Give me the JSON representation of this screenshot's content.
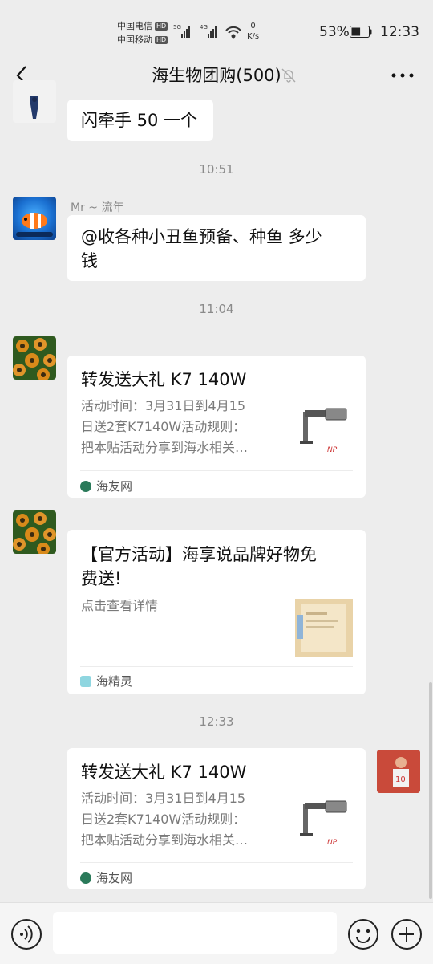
{
  "status_bar": {
    "carrier_1": "中国电信",
    "carrier_2": "中国移动",
    "hd_badge": "HD",
    "net_1": "5G",
    "net_2": "4G",
    "speed_value": "0",
    "speed_unit": "K/s",
    "battery_pct": "53%",
    "battery_level": 0.53,
    "time": "12:33"
  },
  "header": {
    "title": "海生物团购(500)"
  },
  "messages": [
    {
      "type": "text",
      "text": "闪牵手 50 一个"
    },
    {
      "type": "time",
      "text": "10:51"
    },
    {
      "type": "text",
      "sender": "Mr ~ 流年",
      "text_line1": "@收各种小丑鱼预备、种鱼  多少",
      "text_line2": "钱"
    },
    {
      "type": "time",
      "text": "11:04"
    },
    {
      "type": "card",
      "title": "转发送大礼 K7 140W",
      "desc_line1": "活动时间：3月31日到4月15",
      "desc_line2": "日送2套K7140W活动规则：",
      "desc_line3": "把本贴活动分享到海水相关…",
      "source": "海友网"
    },
    {
      "type": "card",
      "title_line1": "【官方活动】海享说品牌好物免",
      "title_line2": "费送!",
      "desc": "点击查看详情",
      "source": "海精灵"
    },
    {
      "type": "time",
      "text": "12:33"
    },
    {
      "type": "card",
      "title": "转发送大礼 K7 140W",
      "desc_line1": "活动时间：3月31日到4月15",
      "desc_line2": "日送2套K7140W活动规则：",
      "desc_line3": "把本贴活动分享到海水相关…",
      "source": "海友网"
    }
  ],
  "colors": {
    "background": "#ededed",
    "bubble": "#ffffff",
    "text": "#111111",
    "meta": "#8a8a8a"
  },
  "icons": [
    "back-icon",
    "mute-icon",
    "more-icon",
    "voice-icon",
    "emoji-icon",
    "plus-icon"
  ]
}
